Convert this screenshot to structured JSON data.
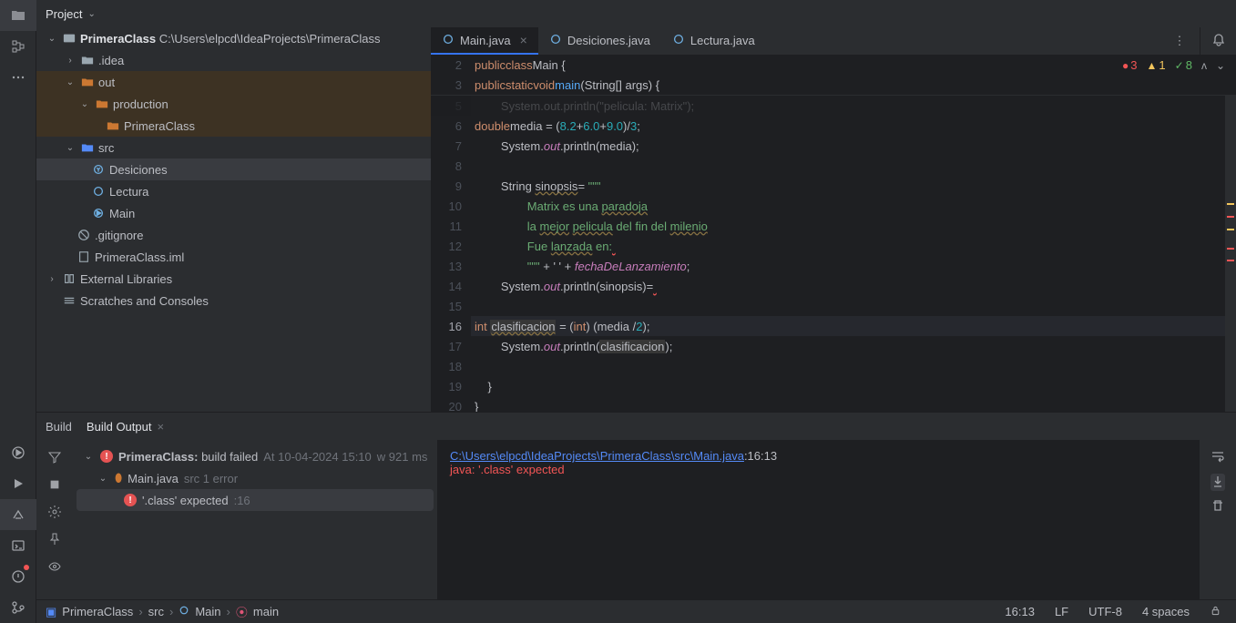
{
  "panel": {
    "title": "Project"
  },
  "tree": {
    "root": {
      "name": "PrimeraClass",
      "path": "C:\\Users\\elpcd\\IdeaProjects\\PrimeraClass"
    },
    "idea": ".idea",
    "out": "out",
    "production": "production",
    "primeraclass_out": "PrimeraClass",
    "src": "src",
    "desiciones": "Desiciones",
    "lectura": "Lectura",
    "main": "Main",
    "gitignore": ".gitignore",
    "iml": "PrimeraClass.iml",
    "ext": "External Libraries",
    "scratch": "Scratches and Consoles"
  },
  "tabs": [
    {
      "label": "Main.java",
      "active": true
    },
    {
      "label": "Desiciones.java",
      "active": false
    },
    {
      "label": "Lectura.java",
      "active": false
    }
  ],
  "sticky": {
    "l2": "2",
    "l3": "3",
    "c2a": "public",
    "c2b": "class",
    "c2c": "Main {",
    "c3a": "public",
    "c3b": "static",
    "c3c": "void",
    "c3d": "main",
    "c3e": "(String[] args) {"
  },
  "indicators": {
    "errors": "3",
    "warnings": "1",
    "ok": "8"
  },
  "code": {
    "r5": {
      "n": "5",
      "t": "        System.out.println(\"pelicula: Matrix\");"
    },
    "r6": {
      "n": "6"
    },
    "r7": {
      "n": "7"
    },
    "r8": {
      "n": "8"
    },
    "r9": {
      "n": "9"
    },
    "r10": {
      "n": "10"
    },
    "r11": {
      "n": "11"
    },
    "r12": {
      "n": "12"
    },
    "r13": {
      "n": "13"
    },
    "r14": {
      "n": "14"
    },
    "r15": {
      "n": "15"
    },
    "r16": {
      "n": "16"
    },
    "r17": {
      "n": "17"
    },
    "r18": {
      "n": "18"
    },
    "r19": {
      "n": "19",
      "t": "    }"
    },
    "r20": {
      "n": "20",
      "t": "}"
    },
    "t6_kw": "double",
    "t6_var": "media",
    "t6_eq": " = (",
    "t6_n1": "8.2",
    "t6_p": "+",
    "t6_n2": "6.0",
    "t6_p2": "+",
    "t6_n3": "9.0",
    "t6_rest": ")/",
    "t6_n4": "3",
    "t6_end": ";",
    "t7_pre": "        System.",
    "t7_out": "out",
    "t7_post": ".println(media);",
    "t9_pre": "        String ",
    "t9_var": "sinopsis",
    "t9_eq": "= ",
    "t9_q": "\"\"\"",
    "t10": "                Matrix es una ",
    "t10b": "paradoja",
    "t11": "                la ",
    "t11b": "mejor",
    "t11c": " ",
    "t11d": "pelicula",
    "t11e": " del fin del ",
    "t11f": "milenio",
    "t12": "                Fue ",
    "t12b": "lanzada",
    "t12c": " en:",
    "t12d": " ",
    "t13": "                \"\"\"",
    "t13b": " + ' ' + ",
    "t13c": "fechaDeLanzamiento",
    "t13d": ";",
    "t14_pre": "        System.",
    "t14_out": "out",
    "t14_post": ".println(sinopsis)=",
    "t14_err": " ",
    "t16_kw": "int",
    "t16_sp": " ",
    "t16_var": "clasificacion",
    "t16_eq": " = (",
    "t16_cast": "int",
    "t16_rest": ") (media /",
    "t16_n": "2",
    "t16_end": ");",
    "t17_pre": "        System.",
    "t17_out": "out",
    "t17_post": ".println(",
    "t17_var": "clasificacion",
    "t17_end": ");"
  },
  "build": {
    "tab1": "Build",
    "tab2": "Build Output",
    "row1_name": "PrimeraClass:",
    "row1_status": "build failed",
    "row1_time": "At 10-04-2024 15:10",
    "row1_dur": "w 921 ms",
    "row2_name": "Main.java",
    "row2_status": "src 1 error",
    "row3_name": "'.class' expected",
    "row3_pos": ":16",
    "out_path": "C:\\Users\\elpcd\\IdeaProjects\\PrimeraClass\\src\\Main.java",
    "out_pos": ":16:13",
    "out_err": "java: '.class' expected"
  },
  "crumbs": {
    "c1": "PrimeraClass",
    "c2": "src",
    "c3": "Main",
    "c4": "main"
  },
  "status": {
    "pos": "16:13",
    "le": "LF",
    "enc": "UTF-8",
    "indent": "4 spaces"
  }
}
